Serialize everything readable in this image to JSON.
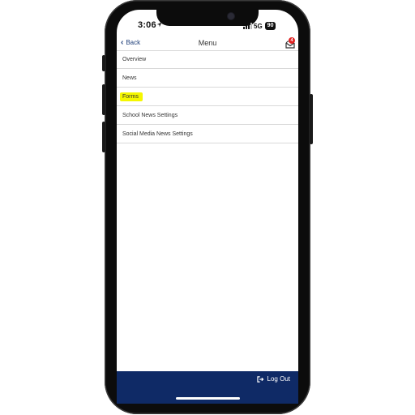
{
  "status_bar": {
    "time": "3:06",
    "network": "5G",
    "battery": "90"
  },
  "navbar": {
    "back_label": "Back",
    "title": "Menu",
    "inbox_badge": "4"
  },
  "menu": {
    "items": [
      {
        "label": "Overview"
      },
      {
        "label": "News"
      },
      {
        "label": "Forms"
      },
      {
        "label": "School News Settings"
      },
      {
        "label": "Social Media News Settings"
      }
    ]
  },
  "footer": {
    "logout_label": "Log Out"
  },
  "colors": {
    "footer_background": "#0f2a66",
    "back_link": "#1f3f7a",
    "highlight": "#f5f700",
    "badge": "#e02424"
  }
}
